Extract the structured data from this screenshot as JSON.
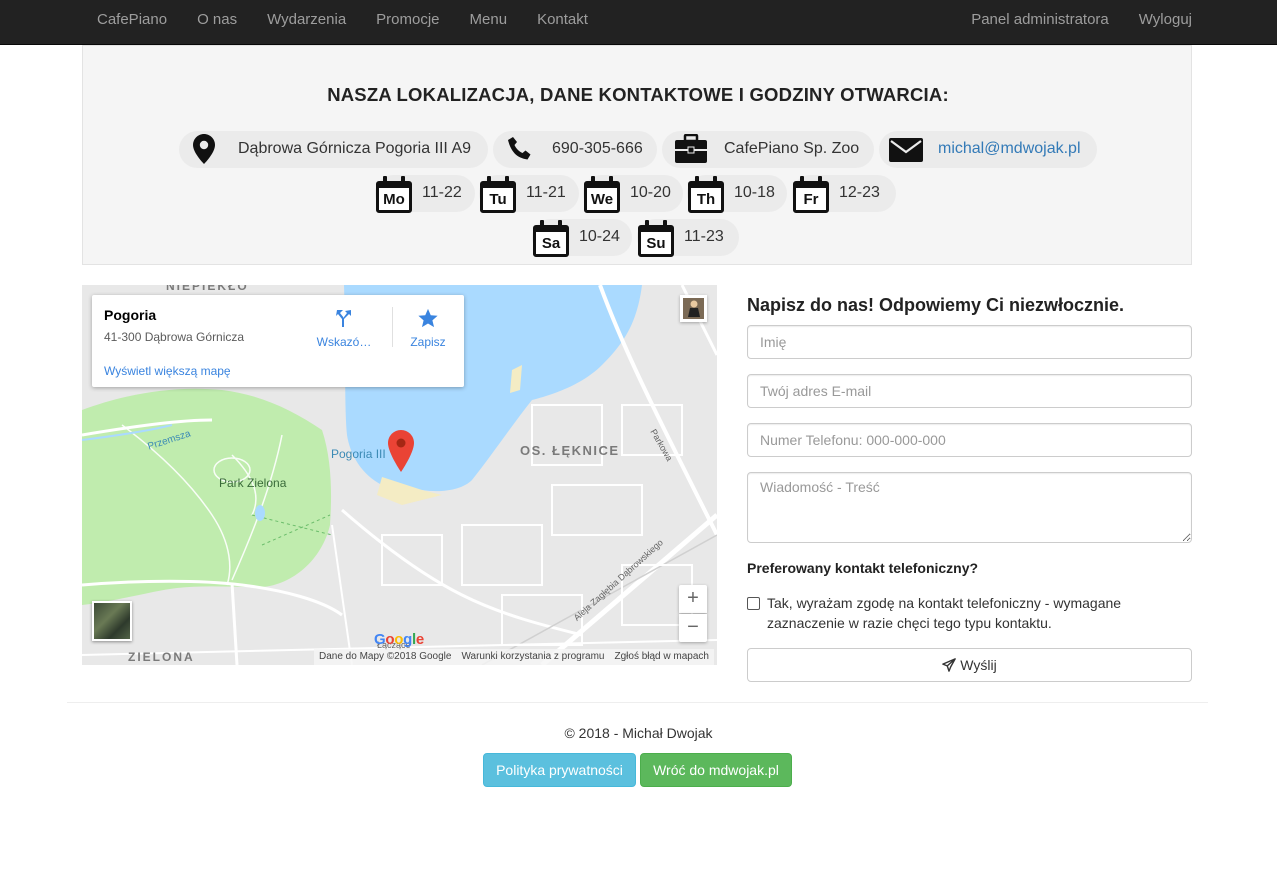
{
  "navbar": {
    "brand": "CafePiano",
    "left_items": [
      "O nas",
      "Wydarzenia",
      "Promocje",
      "Menu",
      "Kontakt"
    ],
    "right_items": [
      "Panel administratora",
      "Wyloguj"
    ]
  },
  "contact": {
    "title": "NASZA LOKALIZACJA, DANE KONTAKTOWE I GODZINY OTWARCIA:",
    "address": "Dąbrowa Górnicza Pogoria III A9",
    "phone": "690-305-666",
    "company": "CafePiano Sp. Zoo",
    "email": "michal@mdwojak.pl",
    "icons": [
      "map-marker-icon",
      "phone-icon",
      "briefcase-icon",
      "envelope-icon",
      "calendar-icon"
    ],
    "hours": [
      {
        "day": "Mo",
        "hours": "11-22"
      },
      {
        "day": "Tu",
        "hours": "11-21"
      },
      {
        "day": "We",
        "hours": "10-20"
      },
      {
        "day": "Th",
        "hours": "10-18"
      },
      {
        "day": "Fr",
        "hours": "12-23"
      },
      {
        "day": "Sa",
        "hours": "10-24"
      },
      {
        "day": "Su",
        "hours": "11-23"
      }
    ]
  },
  "map": {
    "place_name": "Pogoria",
    "place_address": "41-300 Dąbrowa Górnicza",
    "bigger_map_link": "Wyświetl większą mapę",
    "directions_label": "Wskazó…",
    "save_label": "Zapisz",
    "labels": {
      "niepiekle": "NIEPIEKŁO",
      "pogoria": "Pogoria III",
      "leknice": "OS. ŁĘKNICE",
      "park": "Park Zielona",
      "przemsza": "Przemsza",
      "parkowa": "Parkowa",
      "aleja": "Aleja Zagłębia Dąbrowskiego",
      "zielona": "ZIELONA",
      "laczace": "Łączące"
    },
    "zoom_in": "+",
    "zoom_out": "−",
    "google": "Google",
    "attribution": [
      "Dane do Mapy ©2018 Google",
      "Warunki korzystania z programu",
      "Zgłoś błąd w mapach"
    ],
    "colors": {
      "water": "#aadaff",
      "park": "#c0ecae",
      "land": "#e8e8e8",
      "pin": "#ea4335"
    }
  },
  "form": {
    "title": "Napisz do nas! Odpowiemy Ci niezwłocznie.",
    "name_placeholder": "Imię",
    "email_placeholder": "Twój adres E-mail",
    "phone_placeholder": "Numer Telefonu: 000-000-000",
    "message_placeholder": "Wiadomość - Treść",
    "pref_label": "Preferowany kontakt telefoniczny?",
    "consent_text": "Tak, wyrażam zgodę na kontakt telefoniczny - wymagane zaznaczenie w razie chęci tego typu kontaktu.",
    "consent_checked": false,
    "send_label": "Wyślij"
  },
  "footer": {
    "copyright": "© 2018 - Michał Dwojak",
    "privacy_button": "Polityka prywatności",
    "back_button": "Wróć do mdwojak.pl",
    "colors": {
      "info": "#5bc0de",
      "success": "#5cb85c"
    }
  }
}
